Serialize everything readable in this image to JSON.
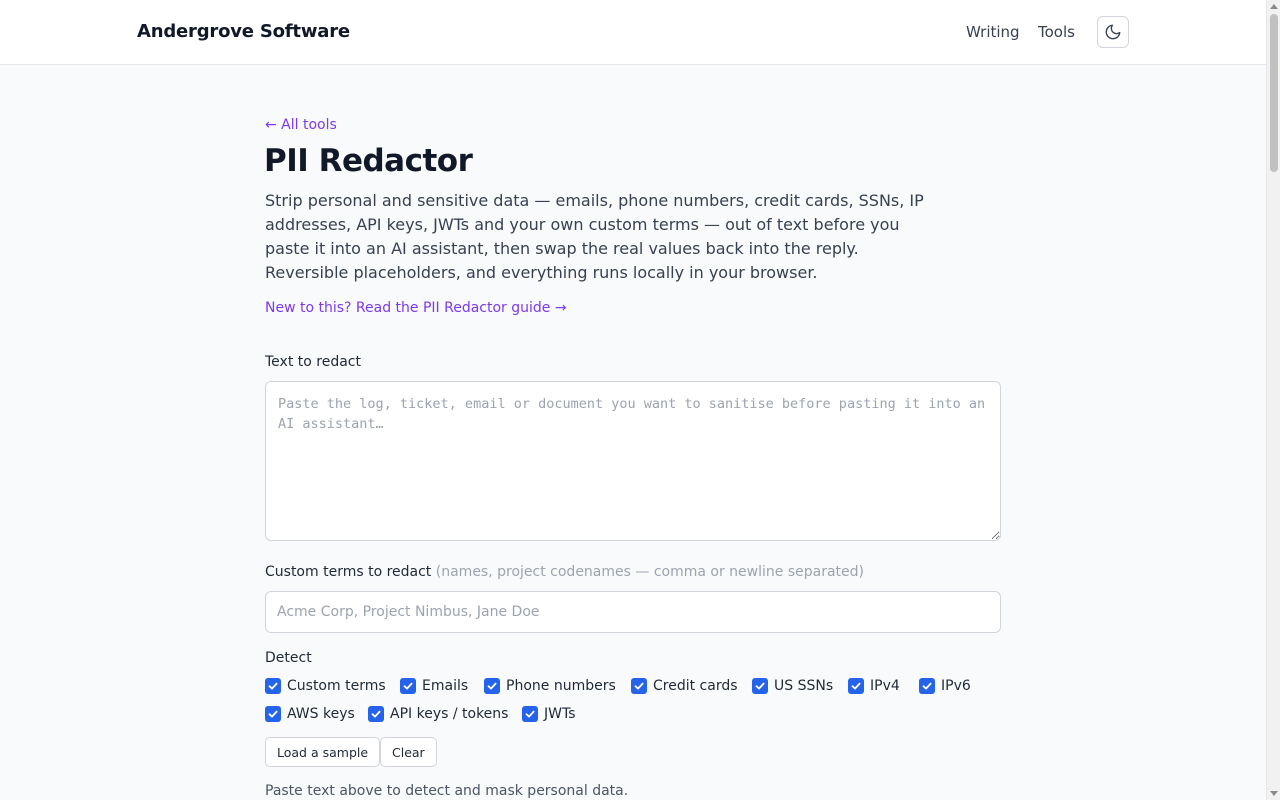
{
  "header": {
    "brand": "Andergrove Software",
    "nav": [
      {
        "label": "Writing"
      },
      {
        "label": "Tools"
      }
    ],
    "theme_toggle_icon": "moon-icon"
  },
  "main": {
    "back_link": "← All tools",
    "title": "PII Redactor",
    "description": "Strip personal and sensitive data — emails, phone numbers, credit cards, SSNs, IP addresses, API keys, JWTs and your own custom terms — out of text before you paste it into an AI assistant, then swap the real values back into the reply. Reversible placeholders, and everything runs locally in your browser.",
    "guide_link": "New to this? Read the PII Redactor guide →",
    "text_field": {
      "label": "Text to redact",
      "value": "",
      "placeholder": "Paste the log, ticket, email or document you want to sanitise before pasting it into an AI assistant…"
    },
    "custom_terms": {
      "label": "Custom terms to redact",
      "hint": "(names, project codenames — comma or newline separated)",
      "value": "",
      "placeholder": "Acme Corp, Project Nimbus, Jane Doe"
    },
    "detect": {
      "label": "Detect",
      "options": [
        {
          "label": "Custom terms",
          "checked": true
        },
        {
          "label": "Emails",
          "checked": true
        },
        {
          "label": "Phone numbers",
          "checked": true
        },
        {
          "label": "Credit cards",
          "checked": true
        },
        {
          "label": "US SSNs",
          "checked": true
        },
        {
          "label": "IPv4",
          "checked": true
        },
        {
          "label": "IPv6",
          "checked": true
        },
        {
          "label": "AWS keys",
          "checked": true
        },
        {
          "label": "API keys / tokens",
          "checked": true
        },
        {
          "label": "JWTs",
          "checked": true
        }
      ]
    },
    "buttons": {
      "load_sample": "Load a sample",
      "clear": "Clear"
    },
    "status": "Paste text above to detect and mask personal data."
  },
  "colors": {
    "accent": "#7c3aed",
    "checkbox": "#2563eb"
  }
}
